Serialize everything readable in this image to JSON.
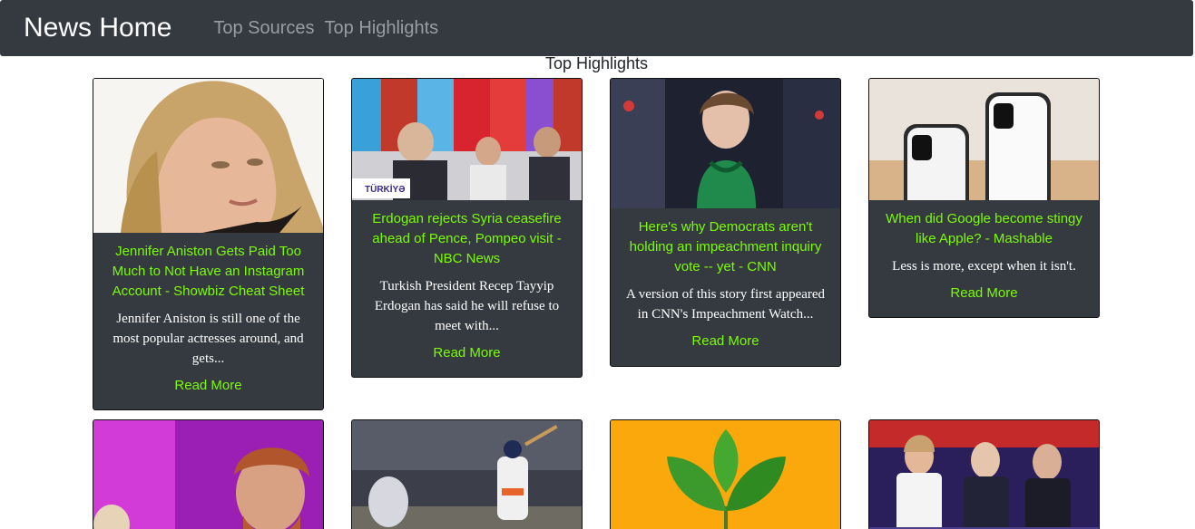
{
  "navbar": {
    "brand": "News Home",
    "links": [
      "Top Sources",
      "Top Highlights"
    ]
  },
  "section_title": "Top Highlights",
  "cards": [
    {
      "title": "Jennifer Aniston Gets Paid Too Much to Not Have an Instagram Account - Showbiz Cheat Sheet",
      "description": "Jennifer Aniston is still one of the most popular actresses around, and gets...",
      "read_more": "Read More"
    },
    {
      "title": "Erdogan rejects Syria ceasefire ahead of Pence, Pompeo visit - NBC News",
      "description": "Turkish President Recep Tayyip Erdogan has said he will refuse to meet with...",
      "read_more": "Read More",
      "image_caption": "TÜRKİYƏ"
    },
    {
      "title": "Here's why Democrats aren't holding an impeachment inquiry vote -- yet - CNN",
      "description": "A version of this story first appeared in CNN's Impeachment Watch...",
      "read_more": "Read More"
    },
    {
      "title": "When did Google become stingy like Apple? - Mashable",
      "description": "Less is more, except when it isn't.",
      "read_more": "Read More"
    }
  ],
  "bottom_cards": [
    {
      "image": "prince-photo"
    },
    {
      "image": "baseball-photo"
    },
    {
      "image": "plant-leaves-photo"
    },
    {
      "image": "debate-panel-photo"
    }
  ]
}
